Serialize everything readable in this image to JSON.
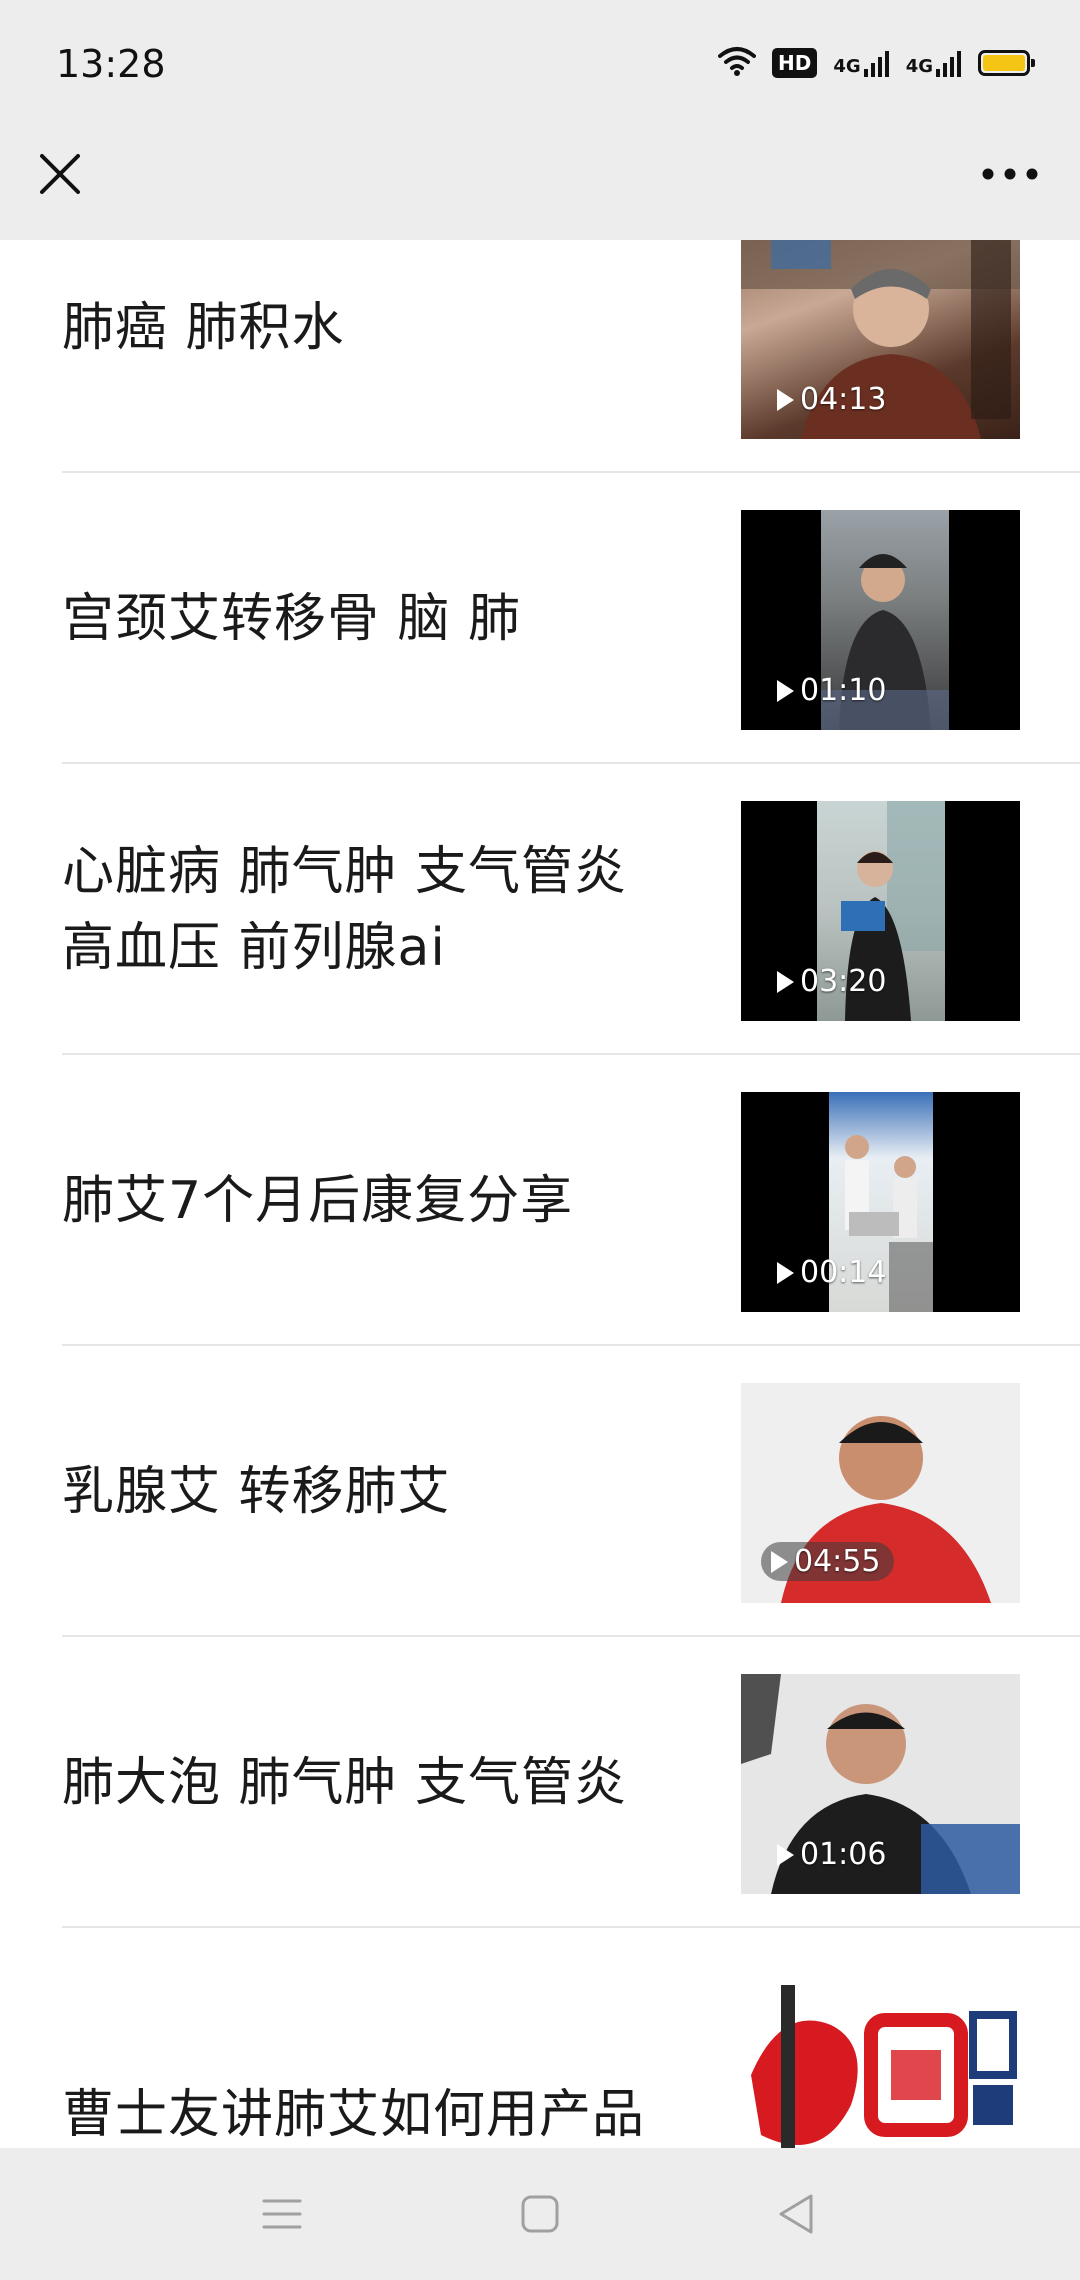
{
  "status_bar": {
    "time": "13:28",
    "hd_label": "HD",
    "network_1": "4G",
    "network_2": "4G",
    "battery_color": "#f4c515"
  },
  "top_bar": {
    "close_icon": "close-icon",
    "more_icon": "more-dots-icon"
  },
  "videos": [
    {
      "title": "肺癌 肺积水",
      "duration": "04:13"
    },
    {
      "title": "宫颈艾转移骨 脑 肺",
      "duration": "01:10"
    },
    {
      "title": "心脏病 肺气肿 支气管炎 高血压 前列腺ai",
      "duration": "03:20"
    },
    {
      "title": "肺艾7个月后康复分享",
      "duration": "00:14"
    },
    {
      "title": "乳腺艾 转移肺艾",
      "duration": "04:55"
    },
    {
      "title": "肺大泡 肺气肿 支气管炎",
      "duration": "01:06"
    },
    {
      "title": "曹士友讲肺艾如何用产品和注意点",
      "duration": ""
    }
  ],
  "nav_bar": {
    "menu_icon": "menu-icon",
    "home_icon": "home-square-icon",
    "back_icon": "back-triangle-icon"
  }
}
